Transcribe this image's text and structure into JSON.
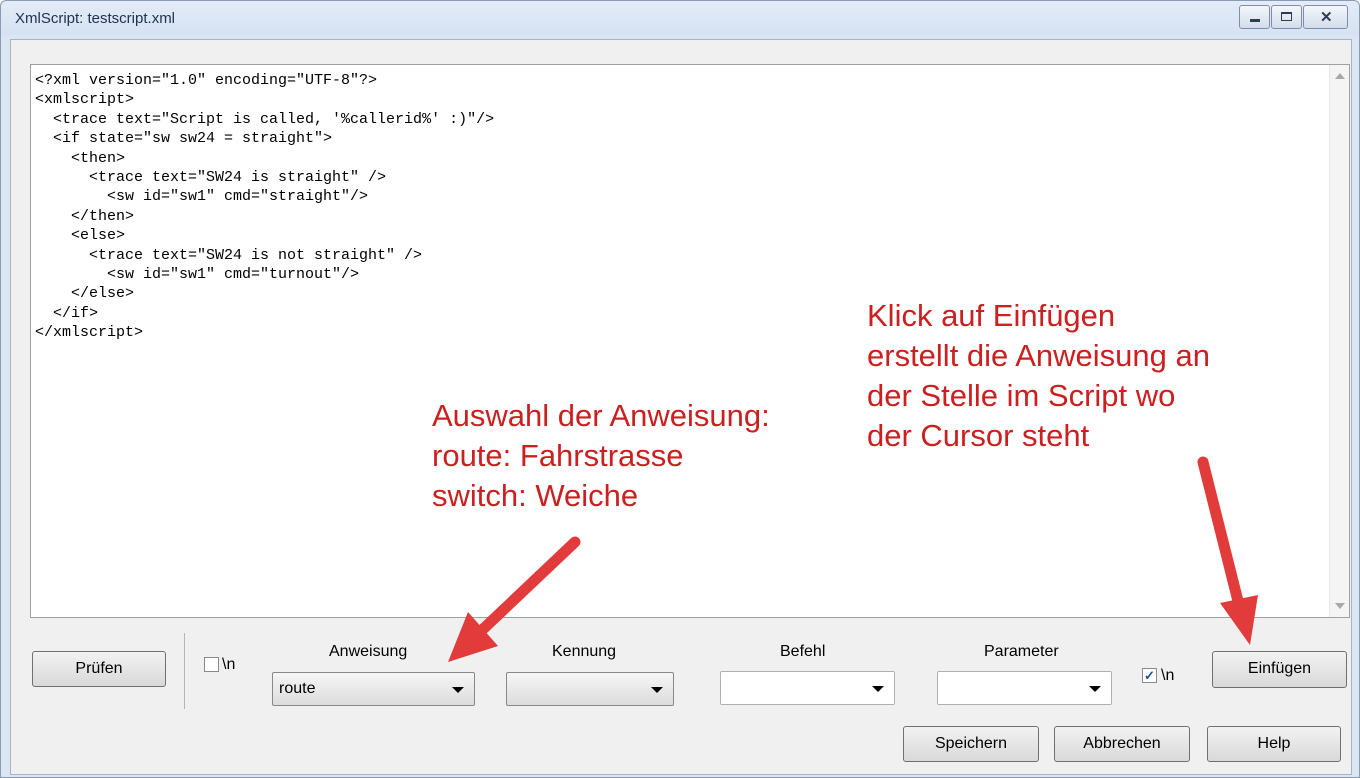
{
  "window": {
    "title": "XmlScript: testscript.xml"
  },
  "editor": {
    "lines": [
      "<?xml version=\"1.0\" encoding=\"UTF-8\"?>",
      "<xmlscript>",
      "  <trace text=\"Script is called, '%callerid%' :)\"/>",
      "  <if state=\"sw sw24 = straight\">",
      "    <then>",
      "      <trace text=\"SW24 is straight\" />",
      "        <sw id=\"sw1\" cmd=\"straight\"/>",
      "    </then>",
      "    <else>",
      "      <trace text=\"SW24 is not straight\" />",
      "        <sw id=\"sw1\" cmd=\"turnout\"/>",
      "    </else>",
      "  </if>",
      "</xmlscript>"
    ]
  },
  "toolbar": {
    "pruefen_label": "Prüfen",
    "newline_left": {
      "label": "\\n",
      "checked": false
    },
    "anweisung": {
      "label": "Anweisung",
      "value": "route"
    },
    "kennung": {
      "label": "Kennung",
      "value": ""
    },
    "befehl": {
      "label": "Befehl",
      "value": ""
    },
    "parameter": {
      "label": "Parameter",
      "value": ""
    },
    "newline_right": {
      "label": "\\n",
      "checked": true
    },
    "einfuegen_label": "Einfügen"
  },
  "footer": {
    "speichern_label": "Speichern",
    "abbrechen_label": "Abbrechen",
    "help_label": "Help"
  },
  "annotations": {
    "left": "Auswahl der Anweisung:\nroute: Fahrstrasse\nswitch: Weiche",
    "right": "Klick auf Einfügen\nerstellt die Anweisung an\nder Stelle im Script wo\nder Cursor steht",
    "color": "#cc1f1f"
  }
}
